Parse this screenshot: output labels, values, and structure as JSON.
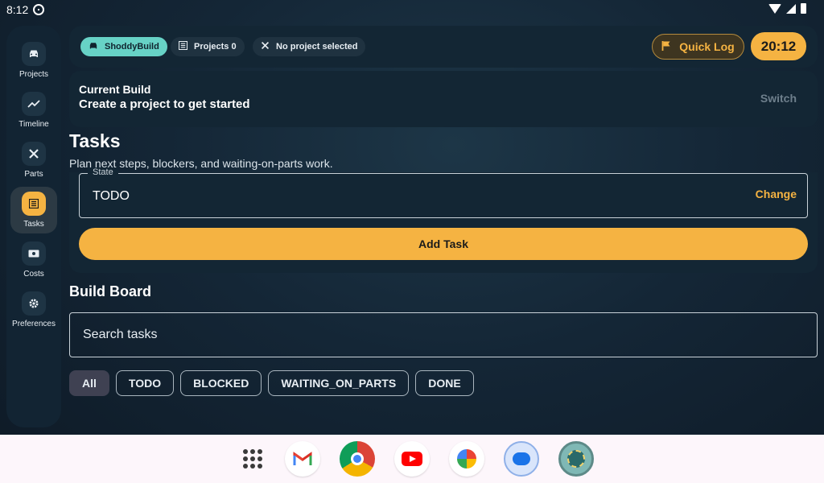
{
  "status_bar": {
    "time": "8:12"
  },
  "nav": {
    "items": [
      {
        "label": "Projects",
        "icon": "car-icon",
        "active": false
      },
      {
        "label": "Timeline",
        "icon": "trend-icon",
        "active": false
      },
      {
        "label": "Parts",
        "icon": "tools-icon",
        "active": false
      },
      {
        "label": "Tasks",
        "icon": "list-icon",
        "active": true
      },
      {
        "label": "Costs",
        "icon": "cash-icon",
        "active": false
      },
      {
        "label": "Preferences",
        "icon": "gear-icon",
        "active": false
      }
    ]
  },
  "header": {
    "app_chip": "ShoddyBuild",
    "projects_chip": "Projects 0",
    "project_chip": "No project selected",
    "quick_log": "Quick Log",
    "clock": "20:12"
  },
  "build": {
    "title": "Current Build",
    "subtitle": "Create a project to get started",
    "switch_label": "Switch"
  },
  "tasks": {
    "title": "Tasks",
    "subtitle": "Plan next steps, blockers, and waiting-on-parts work.",
    "state_label": "State",
    "state_value": "TODO",
    "change_label": "Change",
    "add_task_label": "Add Task"
  },
  "board": {
    "title": "Build Board",
    "search_placeholder": "Search tasks",
    "filters": [
      "All",
      "TODO",
      "BLOCKED",
      "WAITING_ON_PARTS",
      "DONE"
    ],
    "active_filter": "All"
  },
  "colors": {
    "accent": "#f5b342",
    "teal": "#67d2c6",
    "surface": "#132634"
  }
}
